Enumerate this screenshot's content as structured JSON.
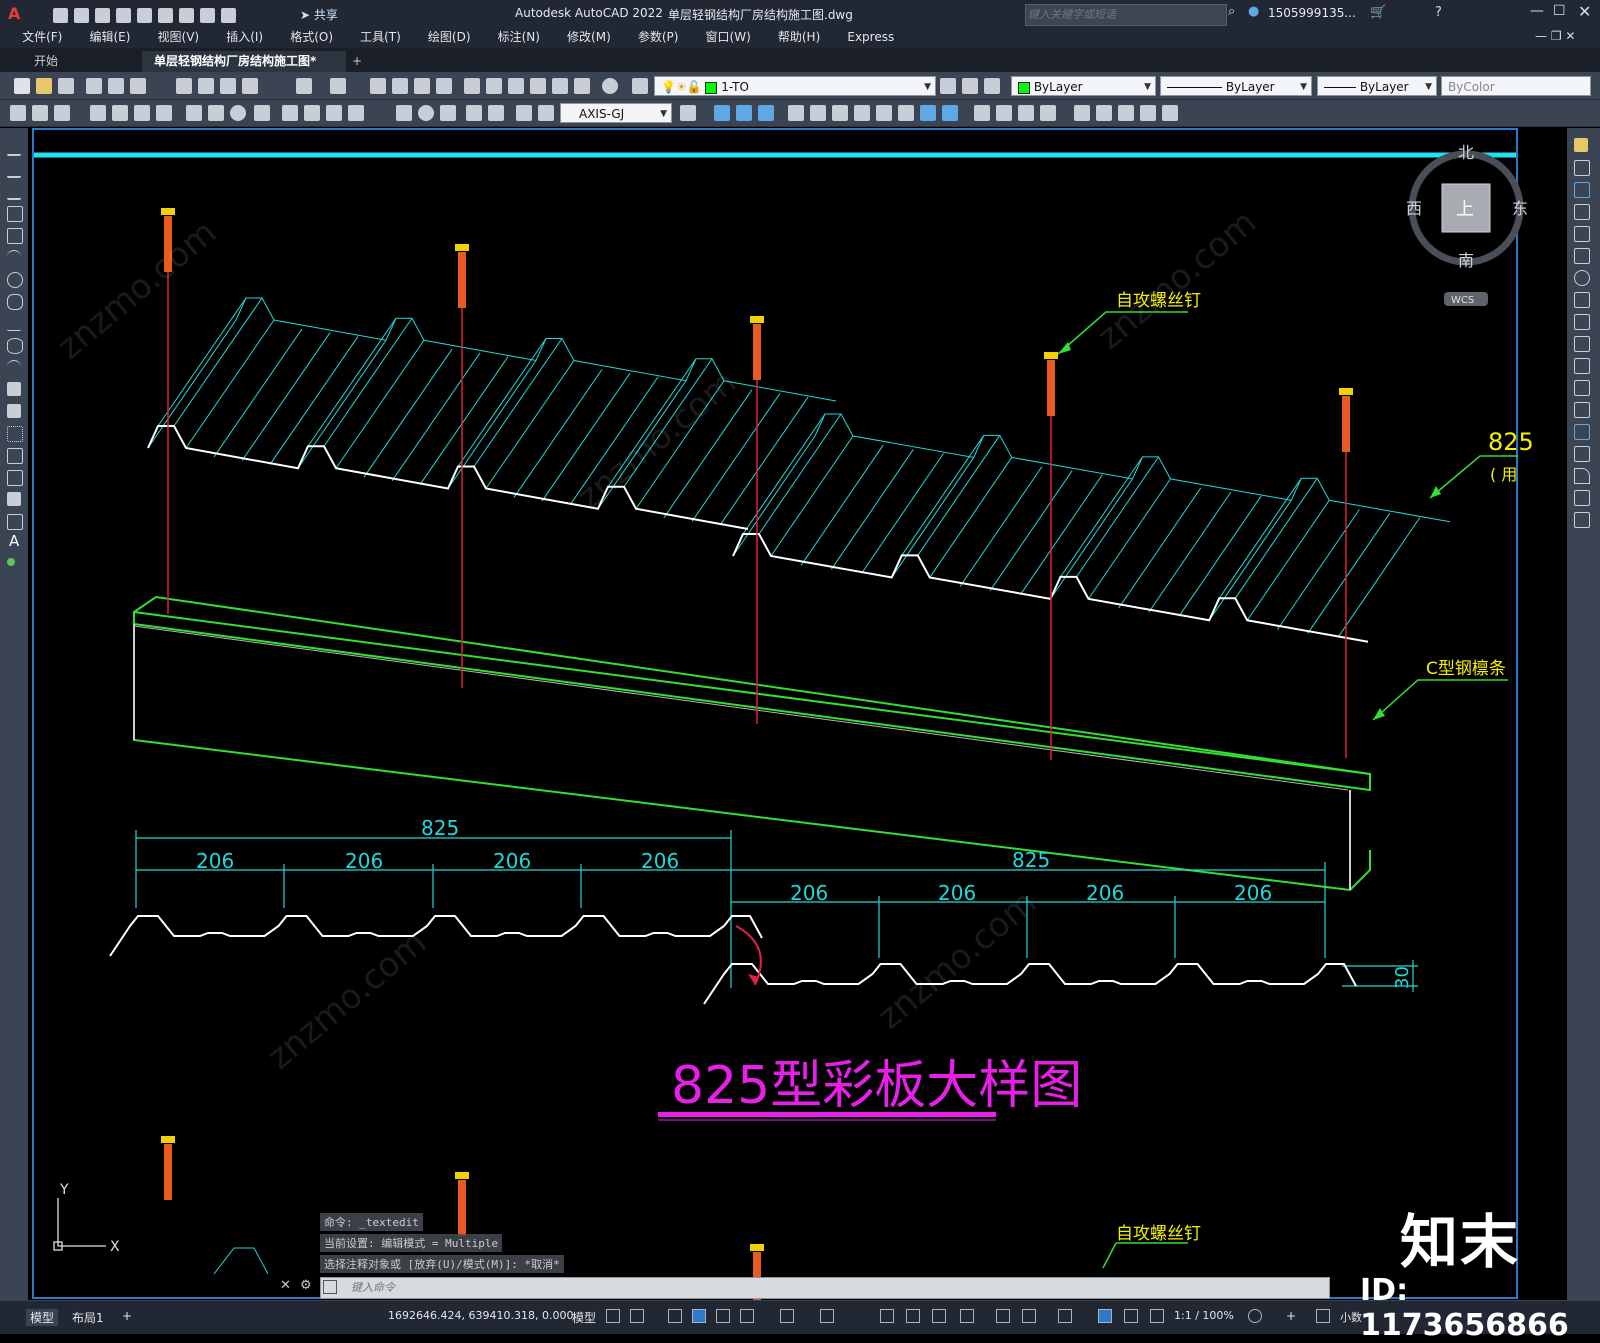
{
  "app": {
    "title": "Autodesk AutoCAD 2022",
    "document": "单层轻钢结构厂房结构施工图.dwg",
    "search_placeholder": "键入关键字或短语",
    "user": "1505999135...",
    "share": "共享"
  },
  "menu": [
    "文件(F)",
    "编辑(E)",
    "视图(V)",
    "插入(I)",
    "格式(O)",
    "工具(T)",
    "绘图(D)",
    "标注(N)",
    "修改(M)",
    "参数(P)",
    "窗口(W)",
    "帮助(H)",
    "Express"
  ],
  "tabs": {
    "start": "开始",
    "active": "单层轻钢结构厂房结构施工图*",
    "add": "+"
  },
  "toolbar": {
    "layer": "1-TO",
    "color": "ByLayer",
    "linetype": "ByLayer",
    "lineweight": "ByLayer",
    "plotstyle": "ByColor",
    "dimstyle": "AXIS-GJ"
  },
  "drawing": {
    "label_screw": "自攻螺丝钉",
    "label_purlin": "C型钢檩条",
    "label_panel_partial": "825",
    "label_panel_partial2": "( 用",
    "dim_total_1": "825",
    "dim_total_2": "825",
    "dim_sub": [
      "206",
      "206",
      "206",
      "206"
    ],
    "dim_height": "30",
    "title": "825型彩板大样图",
    "label_screw_2": "自攻螺丝钉"
  },
  "viewcube": {
    "north": "北",
    "south": "南",
    "east": "东",
    "west": "西",
    "top": "上",
    "wcs": "WCS"
  },
  "ucs": {
    "x": "X",
    "y": "Y"
  },
  "command": {
    "line1": "命令: _textedit",
    "line2": "当前设置: 编辑模式 = Multiple",
    "line3": "选择注释对象或 [放弃(U)/模式(M)]: *取消*",
    "placeholder": "键入命令"
  },
  "status": {
    "layout_model": "模型",
    "layout_1": "布局1",
    "coords": "1692646.424, 639410.318, 0.000",
    "space": "模型",
    "scale": "1:1 / 100%",
    "units": "小数"
  },
  "watermark": {
    "logo": "知末",
    "id": "ID: 1173656866"
  }
}
